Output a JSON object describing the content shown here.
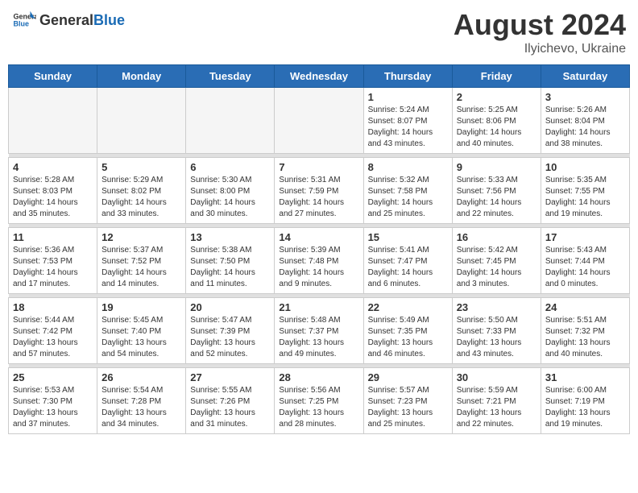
{
  "header": {
    "logo_general": "General",
    "logo_blue": "Blue",
    "title": "August 2024",
    "subtitle": "Ilyichevo, Ukraine"
  },
  "weekdays": [
    "Sunday",
    "Monday",
    "Tuesday",
    "Wednesday",
    "Thursday",
    "Friday",
    "Saturday"
  ],
  "weeks": [
    [
      {
        "day": "",
        "empty": true
      },
      {
        "day": "",
        "empty": true
      },
      {
        "day": "",
        "empty": true
      },
      {
        "day": "",
        "empty": true
      },
      {
        "day": "1",
        "sunrise": "5:24 AM",
        "sunset": "8:07 PM",
        "daylight": "14 hours and 43 minutes."
      },
      {
        "day": "2",
        "sunrise": "5:25 AM",
        "sunset": "8:06 PM",
        "daylight": "14 hours and 40 minutes."
      },
      {
        "day": "3",
        "sunrise": "5:26 AM",
        "sunset": "8:04 PM",
        "daylight": "14 hours and 38 minutes."
      }
    ],
    [
      {
        "day": "4",
        "sunrise": "5:28 AM",
        "sunset": "8:03 PM",
        "daylight": "14 hours and 35 minutes."
      },
      {
        "day": "5",
        "sunrise": "5:29 AM",
        "sunset": "8:02 PM",
        "daylight": "14 hours and 33 minutes."
      },
      {
        "day": "6",
        "sunrise": "5:30 AM",
        "sunset": "8:00 PM",
        "daylight": "14 hours and 30 minutes."
      },
      {
        "day": "7",
        "sunrise": "5:31 AM",
        "sunset": "7:59 PM",
        "daylight": "14 hours and 27 minutes."
      },
      {
        "day": "8",
        "sunrise": "5:32 AM",
        "sunset": "7:58 PM",
        "daylight": "14 hours and 25 minutes."
      },
      {
        "day": "9",
        "sunrise": "5:33 AM",
        "sunset": "7:56 PM",
        "daylight": "14 hours and 22 minutes."
      },
      {
        "day": "10",
        "sunrise": "5:35 AM",
        "sunset": "7:55 PM",
        "daylight": "14 hours and 19 minutes."
      }
    ],
    [
      {
        "day": "11",
        "sunrise": "5:36 AM",
        "sunset": "7:53 PM",
        "daylight": "14 hours and 17 minutes."
      },
      {
        "day": "12",
        "sunrise": "5:37 AM",
        "sunset": "7:52 PM",
        "daylight": "14 hours and 14 minutes."
      },
      {
        "day": "13",
        "sunrise": "5:38 AM",
        "sunset": "7:50 PM",
        "daylight": "14 hours and 11 minutes."
      },
      {
        "day": "14",
        "sunrise": "5:39 AM",
        "sunset": "7:48 PM",
        "daylight": "14 hours and 9 minutes."
      },
      {
        "day": "15",
        "sunrise": "5:41 AM",
        "sunset": "7:47 PM",
        "daylight": "14 hours and 6 minutes."
      },
      {
        "day": "16",
        "sunrise": "5:42 AM",
        "sunset": "7:45 PM",
        "daylight": "14 hours and 3 minutes."
      },
      {
        "day": "17",
        "sunrise": "5:43 AM",
        "sunset": "7:44 PM",
        "daylight": "14 hours and 0 minutes."
      }
    ],
    [
      {
        "day": "18",
        "sunrise": "5:44 AM",
        "sunset": "7:42 PM",
        "daylight": "13 hours and 57 minutes."
      },
      {
        "day": "19",
        "sunrise": "5:45 AM",
        "sunset": "7:40 PM",
        "daylight": "13 hours and 54 minutes."
      },
      {
        "day": "20",
        "sunrise": "5:47 AM",
        "sunset": "7:39 PM",
        "daylight": "13 hours and 52 minutes."
      },
      {
        "day": "21",
        "sunrise": "5:48 AM",
        "sunset": "7:37 PM",
        "daylight": "13 hours and 49 minutes."
      },
      {
        "day": "22",
        "sunrise": "5:49 AM",
        "sunset": "7:35 PM",
        "daylight": "13 hours and 46 minutes."
      },
      {
        "day": "23",
        "sunrise": "5:50 AM",
        "sunset": "7:33 PM",
        "daylight": "13 hours and 43 minutes."
      },
      {
        "day": "24",
        "sunrise": "5:51 AM",
        "sunset": "7:32 PM",
        "daylight": "13 hours and 40 minutes."
      }
    ],
    [
      {
        "day": "25",
        "sunrise": "5:53 AM",
        "sunset": "7:30 PM",
        "daylight": "13 hours and 37 minutes."
      },
      {
        "day": "26",
        "sunrise": "5:54 AM",
        "sunset": "7:28 PM",
        "daylight": "13 hours and 34 minutes."
      },
      {
        "day": "27",
        "sunrise": "5:55 AM",
        "sunset": "7:26 PM",
        "daylight": "13 hours and 31 minutes."
      },
      {
        "day": "28",
        "sunrise": "5:56 AM",
        "sunset": "7:25 PM",
        "daylight": "13 hours and 28 minutes."
      },
      {
        "day": "29",
        "sunrise": "5:57 AM",
        "sunset": "7:23 PM",
        "daylight": "13 hours and 25 minutes."
      },
      {
        "day": "30",
        "sunrise": "5:59 AM",
        "sunset": "7:21 PM",
        "daylight": "13 hours and 22 minutes."
      },
      {
        "day": "31",
        "sunrise": "6:00 AM",
        "sunset": "7:19 PM",
        "daylight": "13 hours and 19 minutes."
      }
    ]
  ]
}
